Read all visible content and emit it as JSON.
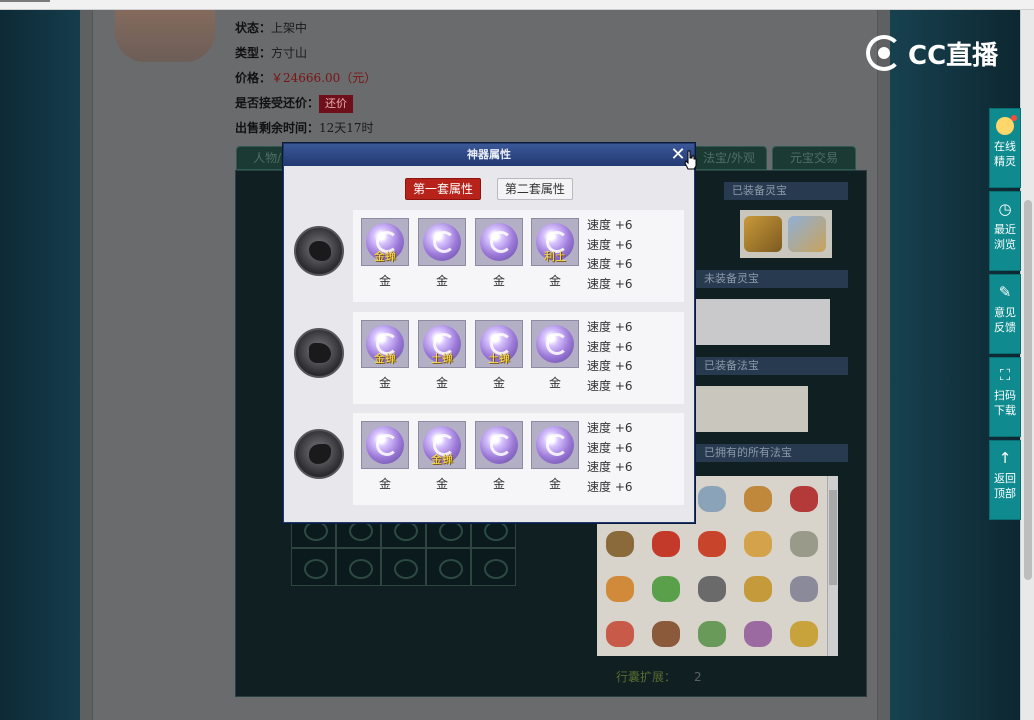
{
  "info": {
    "status_label": "状态：",
    "status_value": "上架中",
    "type_label": "类型：",
    "type_value": "方寸山",
    "price_label": "价格：",
    "price_value": "￥24666.00（元）",
    "bargain_label": "是否接受还价：",
    "bargain_value": "还价",
    "remaining_label": "出售剩余时间：",
    "remaining_value": "12天17时"
  },
  "background": {
    "tabs": [
      "人物/..",
      "..",
      "..",
      "..",
      "..",
      "法宝/外观",
      "元宝交易"
    ],
    "heads": [
      "已装备灵宝",
      "未装备灵宝",
      "已装备法宝",
      "已拥有的所有法宝"
    ],
    "bag_ext_label": "行囊扩展：",
    "bag_ext_value": "2"
  },
  "modal": {
    "title": "神器属性",
    "close": "✕",
    "set_tabs": [
      {
        "label": "第一套属性",
        "active": true
      },
      {
        "label": "第二套属性",
        "active": false
      }
    ],
    "sets": [
      {
        "gems": [
          {
            "tag": "金蝉",
            "label": "金"
          },
          {
            "tag": "",
            "label": "金"
          },
          {
            "tag": "",
            "label": "金"
          },
          {
            "tag": "利土",
            "label": "金"
          }
        ],
        "stats": [
          "速度 +6",
          "速度 +6",
          "速度 +6",
          "速度 +6"
        ]
      },
      {
        "gems": [
          {
            "tag": "金蝉",
            "label": "金"
          },
          {
            "tag": "土蝉",
            "label": "金"
          },
          {
            "tag": "土蝉",
            "label": "金"
          },
          {
            "tag": "",
            "label": "金"
          }
        ],
        "stats": [
          "速度 +6",
          "速度 +6",
          "速度 +6",
          "速度 +6"
        ]
      },
      {
        "gems": [
          {
            "tag": "",
            "label": "金"
          },
          {
            "tag": "金蝉",
            "label": "金"
          },
          {
            "tag": "",
            "label": "金"
          },
          {
            "tag": "",
            "label": "金"
          }
        ],
        "stats": [
          "速度 +6",
          "速度 +6",
          "速度 +6",
          "速度 +6"
        ]
      }
    ]
  },
  "overlay": {
    "logo_text": "CC直播",
    "sidebar": [
      {
        "icon": "avatar-icon",
        "label1": "在线",
        "label2": "精灵"
      },
      {
        "icon": "clock-icon",
        "label1": "最近",
        "label2": "浏览"
      },
      {
        "icon": "edit-icon",
        "label1": "意见",
        "label2": "反馈"
      },
      {
        "icon": "scan-icon",
        "label1": "扫码",
        "label2": "下载"
      },
      {
        "icon": "arrow-up-icon",
        "label1": "返回",
        "label2": "顶部"
      }
    ]
  }
}
